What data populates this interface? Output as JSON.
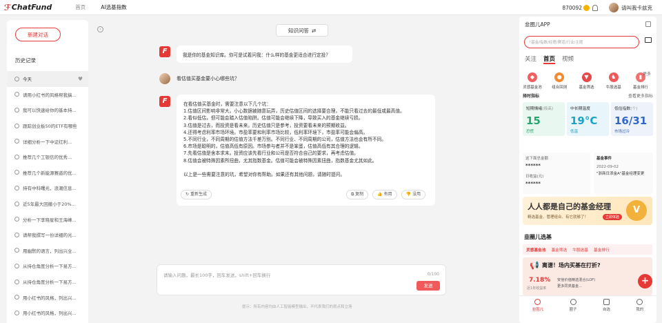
{
  "brand": {
    "logo_text": "ChatFund"
  },
  "nav": {
    "items": [
      "首页",
      "AI选基指数"
    ]
  },
  "account": {
    "points": "870092",
    "user_name": "请叫我卡兹克"
  },
  "sidebar": {
    "new_chat": "新建对话",
    "history_title": "历史记录",
    "items": [
      "今天",
      "请用小红书的风格帮我搞...",
      "我可以快速给你的基本持...",
      "跟踪创业板50的ETF有哪些",
      "详细分析一下中证红利...",
      "推荐几个工银信的优秀...",
      "推荐几个新能源赛道的优...",
      "持有中科曙光，浪潮信息...",
      "近5年最大回撤小于20%...",
      "分析一下李晓星和王海峰...",
      "请帮我撰写一份详细的光...",
      "用幽默的语言，列出兴全...",
      "从持仓角度分析一下易方...",
      "从持仓角度分析一下易方...",
      "用小红书的风格，列出兴...",
      "用小红书的风格，列出兴..."
    ]
  },
  "main": {
    "kb_button": "知识问答",
    "bot_mark": "F",
    "greeting": "我是你的基金知识库。你可是试着问我：什么样的基金更适合进行定投？",
    "question": "看估值买基金要小心哪些坑？",
    "answer_intro": "在看估值买基金时，需要注意以下几个坑：",
    "answer_points": [
      "1.估值区间影响非常大。小心数据被随意玩弄，历史估值区间的选择要合理，不能只看过去的最低或最高值。",
      "2.看似低估，但可能会踏入估值陷阱。估值可能会继续下降，导致买入的基金继续亏损。",
      "3.估值是过去，而投资是看未来。历史估值只是参考，投资要看未来的预期收益。",
      "4.还得考虑利率市场环境。市盈率要和利率市场比较，低利率环境下，市盈率可能会偏高。",
      "5.不同行业，不同周期的估值方法千差万别。不同行业、不同周期的公司，估值方法也会有所不同。",
      "6.市场是聪明的，估值高低有原因。市场参与者并不是笨蛋，估值高低有其合理的逻辑。",
      "7.先看估值是舍本求末。投资应该先看行业和公司是否符合自己的要求，再考虑估值。",
      "8.估值会被特殊因素所扭曲，尤其指数基金。估值可能会被特殊因素扭曲，指数基金尤其如此。"
    ],
    "answer_outro": "以上是一些需要注意的坑，希望对你有帮助。如果还有其他问题，请随时提问。",
    "actions": {
      "regen": "重新生成",
      "copy": "复制",
      "useful": "有用",
      "useless": "没用"
    },
    "input_placeholder": "请输入问题，最长100字，回车发送，shift+回车换行",
    "counter": "0/100",
    "send": "发送",
    "disclaimer": "提示：所有内容均由人工智能模型输出，不代表我们的观点和立场"
  },
  "panel": {
    "title": "韭圈儿APP",
    "search_placeholder": "基金/指数/经理/赛道/行业/主题",
    "tabs": [
      "关注",
      "首页",
      "视频"
    ],
    "icons": [
      {
        "label": "灵感基金池",
        "color": "#f06060"
      },
      {
        "label": "组合回测",
        "color": "#f28b30"
      },
      {
        "label": "基金筛选",
        "color": "#e54848"
      },
      {
        "label": "牛股选基",
        "color": "#ec5a5a"
      },
      {
        "label": "基金排行",
        "color": "#f07070"
      }
    ],
    "more": "更多",
    "temp_title": "择时指标",
    "temp_link": "查看更多指标",
    "temps": [
      {
        "name": "短期情绪",
        "suffix": "(极高)",
        "value": "15",
        "label": "恐慌",
        "bg": "#e9f7f1",
        "color": "#20a96a"
      },
      {
        "name": "中长期温度",
        "suffix": "",
        "value": "19°C",
        "label": "低温",
        "bg": "#e8f5fb",
        "color": "#1aa3c8"
      },
      {
        "name": "低估指数",
        "suffix": "(个)",
        "value": "16/31",
        "label": "市场过冷",
        "bg": "#eef3fb",
        "color": "#3367c7"
      }
    ],
    "assets": {
      "l1": "这下面总金额",
      "v1": "******",
      "l2": "日收益(元)",
      "v2": "******"
    },
    "event": {
      "title": "基金事件",
      "date": "2022-09-02",
      "text": "\"浙商日添金A\"基金经理变更"
    },
    "banner": {
      "title": "人人都是自己的基金经理",
      "sub": "精选基金、管理组合、有它就够了！",
      "cta": "立即体验",
      "logo": "V"
    },
    "circle_title": "韭圈儿选基",
    "circle_tabs": [
      "灵感基金池",
      "基金筛选",
      "牛股选基",
      "基金排行"
    ],
    "post": {
      "title": "离谱！场内买基在打折?",
      "rate": "7.18%",
      "rate_sub": "近1年收益率",
      "line1": "安信价值精选混合(LOF)",
      "line2": "更多同类基金..."
    },
    "bottom": [
      "韭圈儿",
      "圈子",
      "自选",
      "我的"
    ]
  }
}
